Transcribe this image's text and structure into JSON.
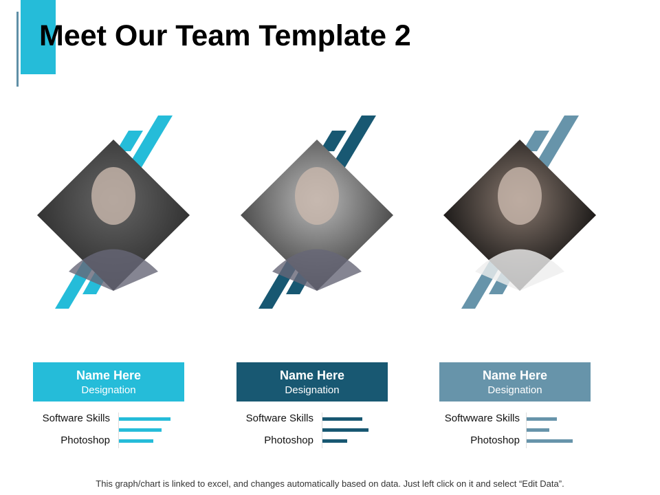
{
  "title": "Meet Our Team Template 2",
  "members": [
    {
      "name": "Name Here",
      "designation": "Designation",
      "color": "#25bcd9",
      "skill1": "Software Skills",
      "skill2": "Photoshop",
      "bars": [
        75,
        62,
        50
      ],
      "photo": "young man with glasses"
    },
    {
      "name": "Name Here",
      "designation": "Designation",
      "color": "#185872",
      "skill1": "Software Skills",
      "skill2": "Photoshop",
      "bars": [
        58,
        67,
        36
      ],
      "photo": "woman with wavy hair"
    },
    {
      "name": "Name Here",
      "designation": "Designation",
      "color": "#6794aa",
      "skill1": "Softwware Skills",
      "skill2": "Photoshop",
      "bars": [
        44,
        33,
        67
      ],
      "photo": "man in white shirt"
    }
  ],
  "footer": "This graph/chart is linked to excel, and changes automatically based on data. Just left click on it and select “Edit Data”."
}
